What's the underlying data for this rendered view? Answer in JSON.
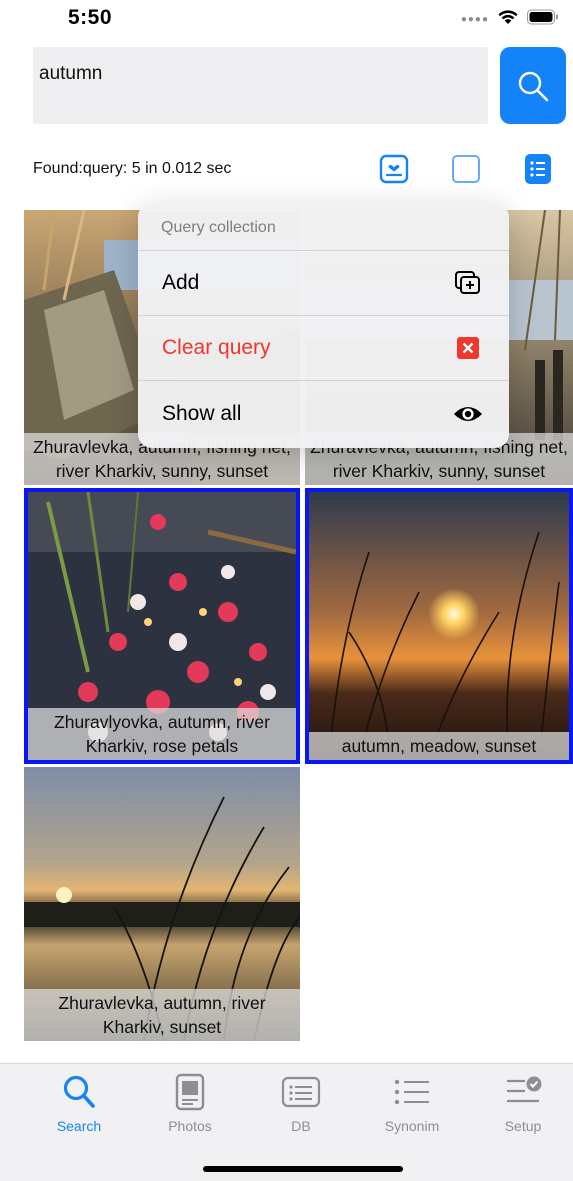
{
  "status": {
    "time": "5:50"
  },
  "search": {
    "value": "autumn"
  },
  "results": {
    "found_text": "Found:query: 5 in 0.012 sec"
  },
  "menu": {
    "title": "Query collection",
    "items": [
      {
        "label": "Add",
        "icon": "add-collection-icon"
      },
      {
        "label": "Clear query",
        "icon": "clear-x-icon",
        "color": "#f0362d"
      },
      {
        "label": "Show all",
        "icon": "eye-icon"
      }
    ]
  },
  "photos": [
    {
      "caption": "Zhuravlevka, autumn, fishing net, river Kharkiv, sunny, sunset",
      "selected": false
    },
    {
      "caption": "Zhuravlevka, autumn, fishing net, river Kharkiv, sunny, sunset",
      "selected": false
    },
    {
      "caption": "Zhuravlyovka, autumn, river Kharkiv, rose petals",
      "selected": true
    },
    {
      "caption": "autumn, meadow, sunset",
      "selected": true
    },
    {
      "caption": "Zhuravlevka, autumn, river Kharkiv, sunset",
      "selected": false
    }
  ],
  "tabs": [
    {
      "label": "Search",
      "icon": "magnifier-icon",
      "active": true
    },
    {
      "label": "Photos",
      "icon": "photos-icon",
      "active": false
    },
    {
      "label": "DB",
      "icon": "db-icon",
      "active": false
    },
    {
      "label": "Synonim",
      "icon": "list-icon",
      "active": false
    },
    {
      "label": "Setup",
      "icon": "setup-icon",
      "active": false
    }
  ],
  "colors": {
    "accent": "#1483f8",
    "selection": "#0a17f5",
    "danger": "#f0362d"
  }
}
